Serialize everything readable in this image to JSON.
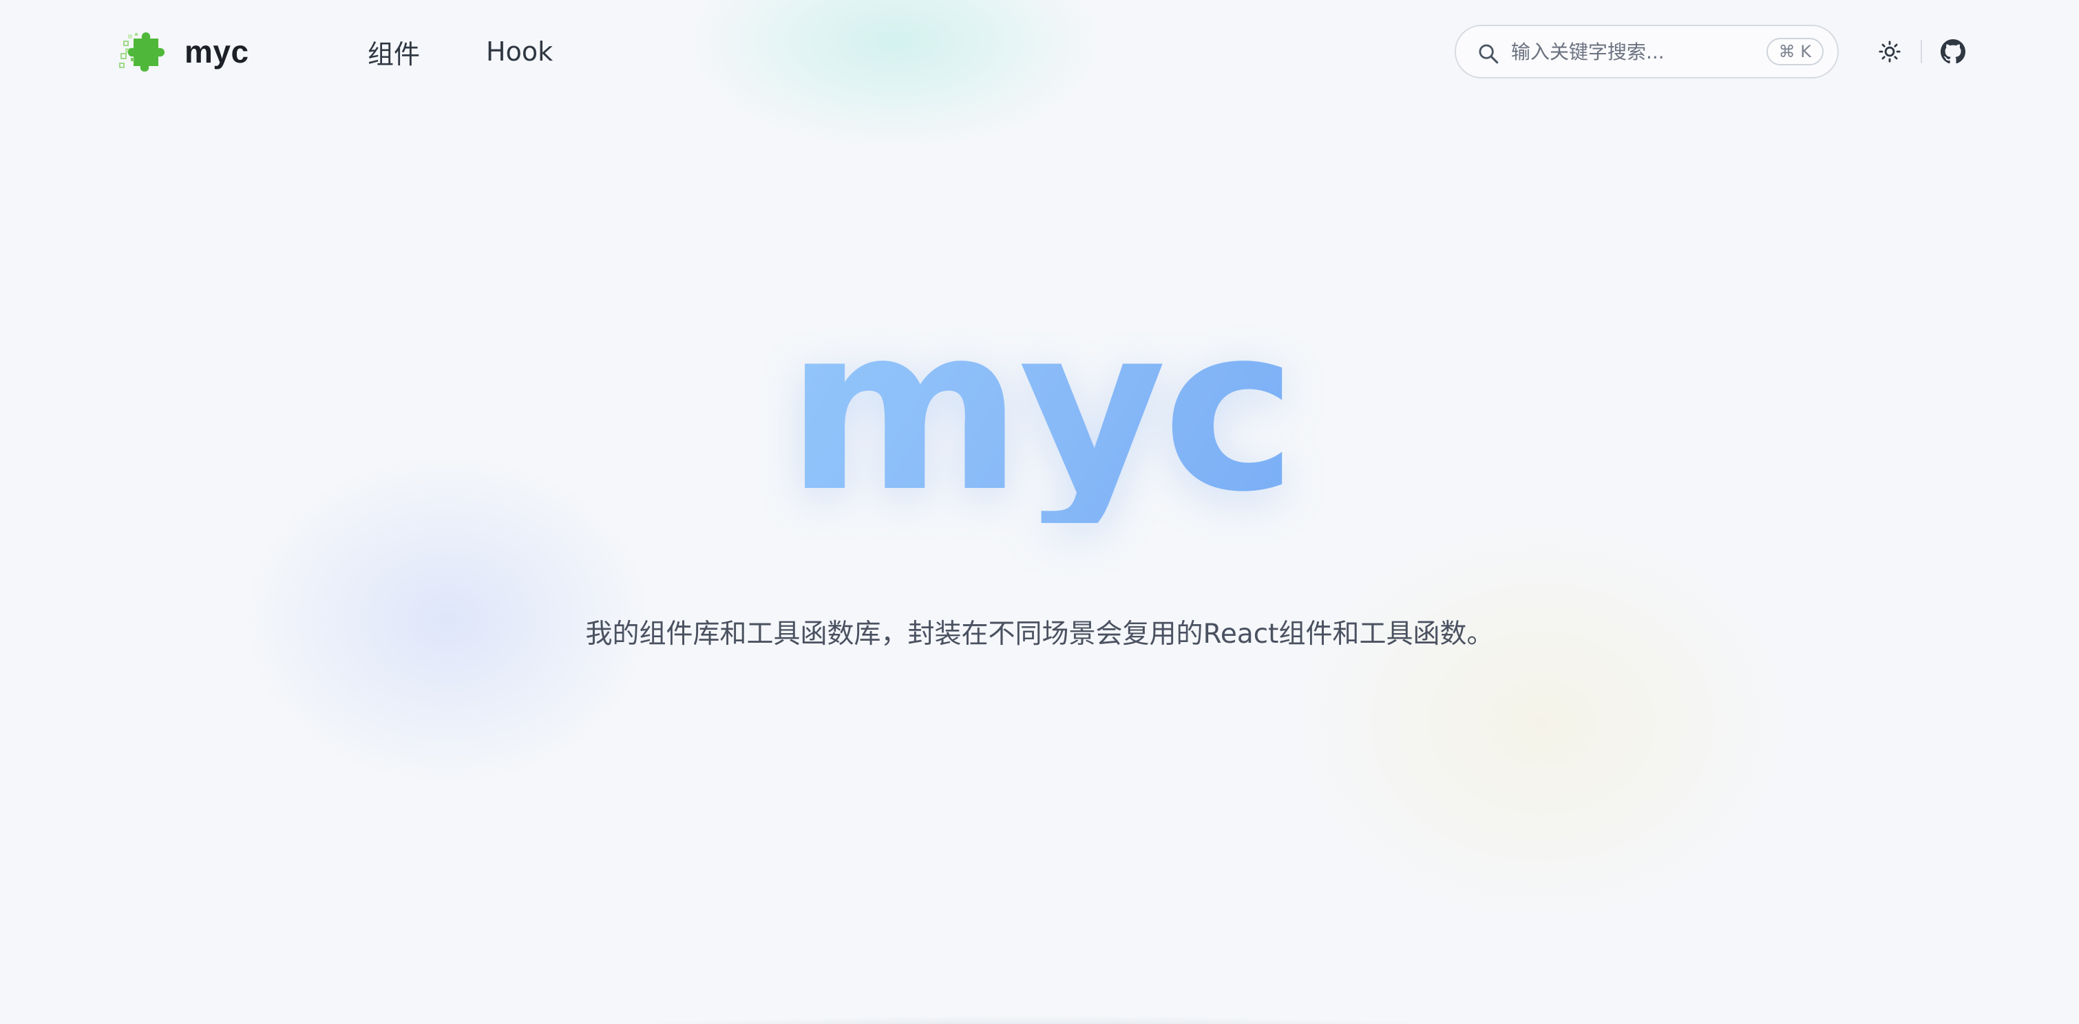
{
  "brand": {
    "name": "myc",
    "logo_icon": "puzzle-piece-icon",
    "logo_color": "#52c41a"
  },
  "nav": {
    "links": [
      {
        "label": "组件"
      },
      {
        "label": "Hook"
      }
    ]
  },
  "search": {
    "placeholder": "输入关键字搜索...",
    "shortcut": "⌘ K",
    "icon": "search-icon"
  },
  "actions": {
    "theme_icon": "sun-icon",
    "github_icon": "github-icon"
  },
  "hero": {
    "title": "myc",
    "description": "我的组件库和工具函数库，封装在不同场景会复用的React组件和工具函数。",
    "title_gradient": [
      "#93c6fb",
      "#7aaef5"
    ]
  }
}
